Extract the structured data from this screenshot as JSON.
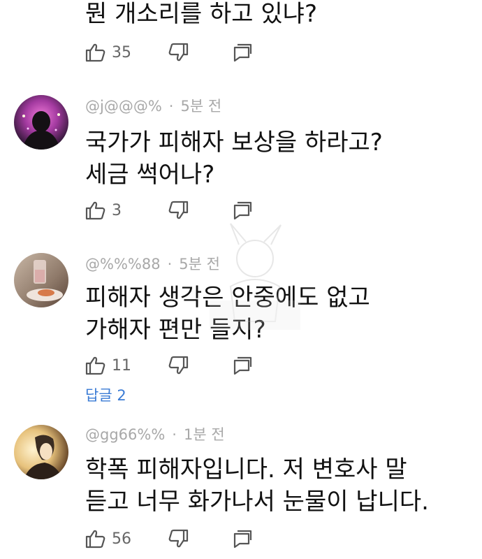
{
  "top_comment": {
    "text": "뭔 개소리를 하고 있냐?",
    "likes": "35"
  },
  "comments": [
    {
      "username": "@j@@@%",
      "separator": "·",
      "time": "5분 전",
      "lines": [
        "국가가 피해자 보상을 하라고?",
        "세금 썩어나?"
      ],
      "likes": "3"
    },
    {
      "username": "@%%%88",
      "separator": "·",
      "time": "5분 전",
      "lines": [
        "피해자 생각은 안중에도 없고",
        "가해자 편만 들지?"
      ],
      "likes": "11",
      "replies_label": "답글 2"
    },
    {
      "username": "@gg66%%",
      "separator": "·",
      "time": "1분 전",
      "lines": [
        "학폭 피해자입니다. 저 변호사 말",
        "듣고 너무 화가나서 눈물이 납니다."
      ],
      "likes": "56"
    }
  ],
  "icons": {
    "like": "thumbs-up-icon",
    "dislike": "thumbs-down-icon",
    "reply": "reply-icon"
  }
}
